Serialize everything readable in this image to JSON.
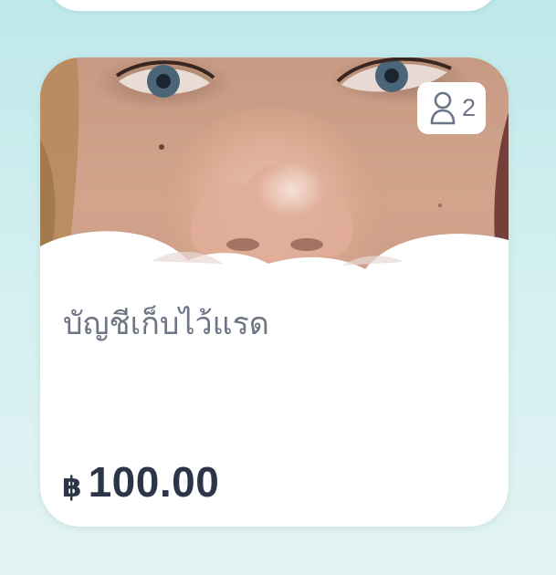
{
  "account_card": {
    "name": "บัญชีเก็บไว้แรด",
    "members": {
      "icon": "person-outline-icon",
      "count": "2"
    },
    "balance": {
      "currency_symbol": "฿",
      "amount": "100.00"
    },
    "photo": "account-cover-photo-face-closeup"
  },
  "colors": {
    "background": "#c7ebec",
    "card": "#ffffff",
    "name_text": "#6e7585",
    "amount_text": "#2c3548",
    "badge_text": "#6b7588"
  }
}
